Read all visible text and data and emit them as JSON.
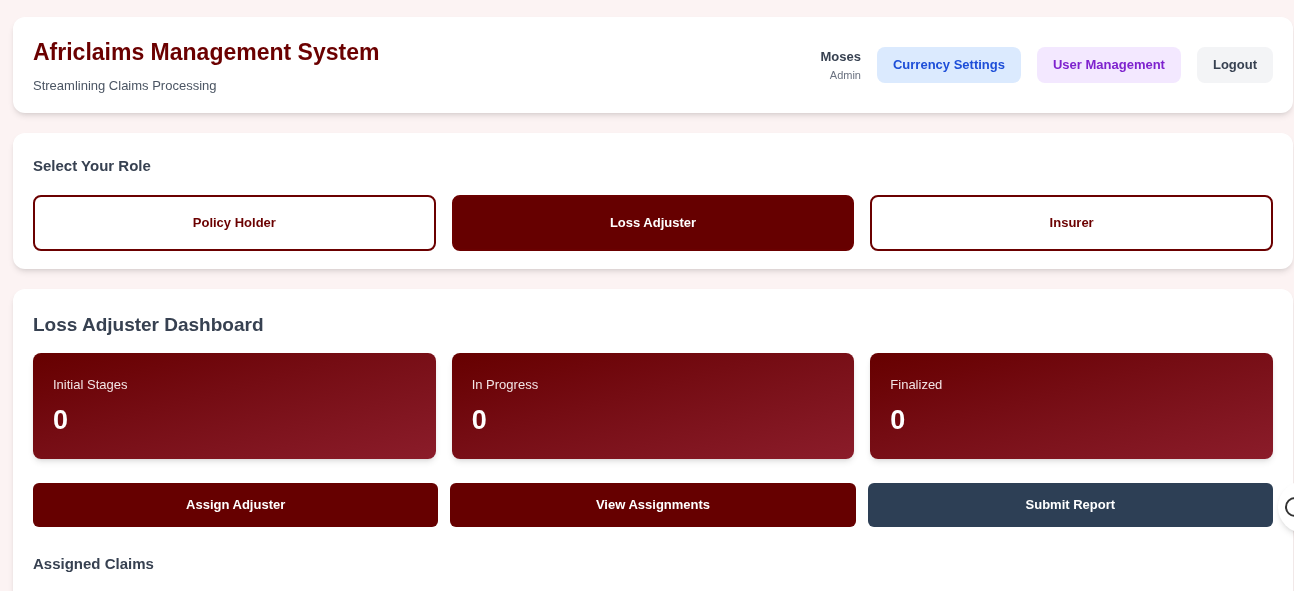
{
  "header": {
    "title": "Africlaims Management System",
    "subtitle": "Streamlining Claims Processing",
    "user": {
      "name": "Moses",
      "role": "Admin"
    },
    "buttons": [
      {
        "label": "Currency Settings",
        "kind": "blue"
      },
      {
        "label": "User Management",
        "kind": "purple"
      },
      {
        "label": "Logout",
        "kind": "gray"
      }
    ]
  },
  "role_selector": {
    "heading": "Select Your Role",
    "roles": [
      {
        "label": "Policy Holder",
        "selected": false
      },
      {
        "label": "Loss Adjuster",
        "selected": true
      },
      {
        "label": "Insurer",
        "selected": false
      }
    ]
  },
  "dashboard": {
    "title": "Loss Adjuster Dashboard",
    "stats": [
      {
        "label": "Initial Stages",
        "value": "0"
      },
      {
        "label": "In Progress",
        "value": "0"
      },
      {
        "label": "Finalized",
        "value": "0"
      }
    ],
    "actions": [
      {
        "label": "Assign Adjuster",
        "kind": "primary"
      },
      {
        "label": "View Assignments",
        "kind": "primary"
      },
      {
        "label": "Submit Report",
        "kind": "secondary"
      }
    ],
    "section_title": "Assigned Claims"
  }
}
